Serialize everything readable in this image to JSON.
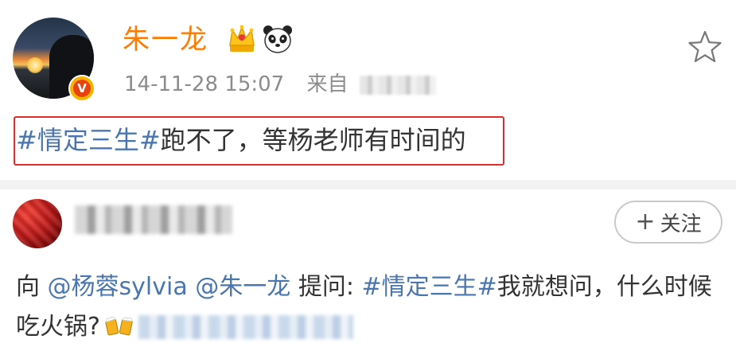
{
  "post": {
    "username": "朱一龙",
    "timestamp": "14-11-28 15:07",
    "source_prefix": "来自",
    "text_tag": "#情定三生#",
    "text_body": "跑不了，等杨老师有时间的",
    "verified_badge": "V"
  },
  "question": {
    "follow_label": "关注",
    "follow_plus": "+",
    "prefix": "向 ",
    "mention1": "@杨蓉sylvia",
    "mention2": "@朱一龙",
    "ask_label": " 提问: ",
    "tag": "#情定三生#",
    "body": "我就想问，什么时候吃火锅?"
  },
  "icons": {
    "crown": "crown-icon",
    "panda": "panda-icon",
    "star": "star-icon",
    "beer": "beer-icon"
  },
  "colors": {
    "username": "#ff7a00",
    "link": "#4a76b0",
    "highlight_border": "#e52b2b",
    "meta": "#8c8c8c"
  }
}
